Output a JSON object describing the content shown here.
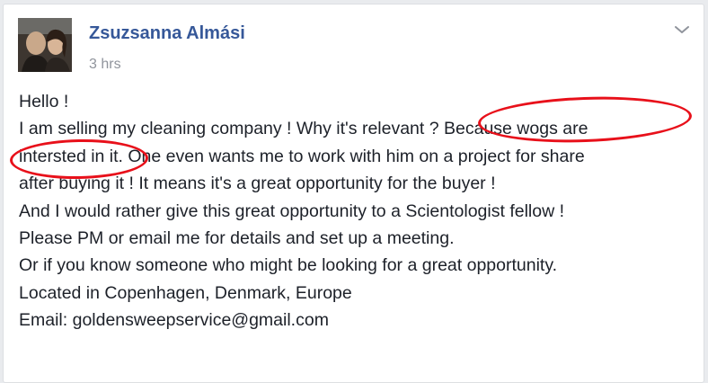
{
  "post": {
    "author": "Zsuzsanna Almási",
    "timestamp": "3 hrs",
    "options_icon": "chevron-down-icon",
    "avatar_icon": "profile-photo",
    "lines": [
      "Hello !",
      "I am selling my cleaning company ! Why it's relevant ? Because wogs are",
      "intersted in it. One even wants me to work with him on a project for share",
      "after buying it ! It means it's a great opportunity for the buyer !",
      "And I would rather give this great opportunity to a Scientologist fellow !",
      "Please PM or email me for details and set up a meeting.",
      "Or if you know someone who might be looking for a great opportunity.",
      "Located in Copenhagen, Denmark, Europe",
      "Email: goldensweepservice@gmail.com"
    ]
  },
  "colors": {
    "author_link": "#365899",
    "annotation": "#e8101a",
    "meta_text": "#90949c"
  }
}
